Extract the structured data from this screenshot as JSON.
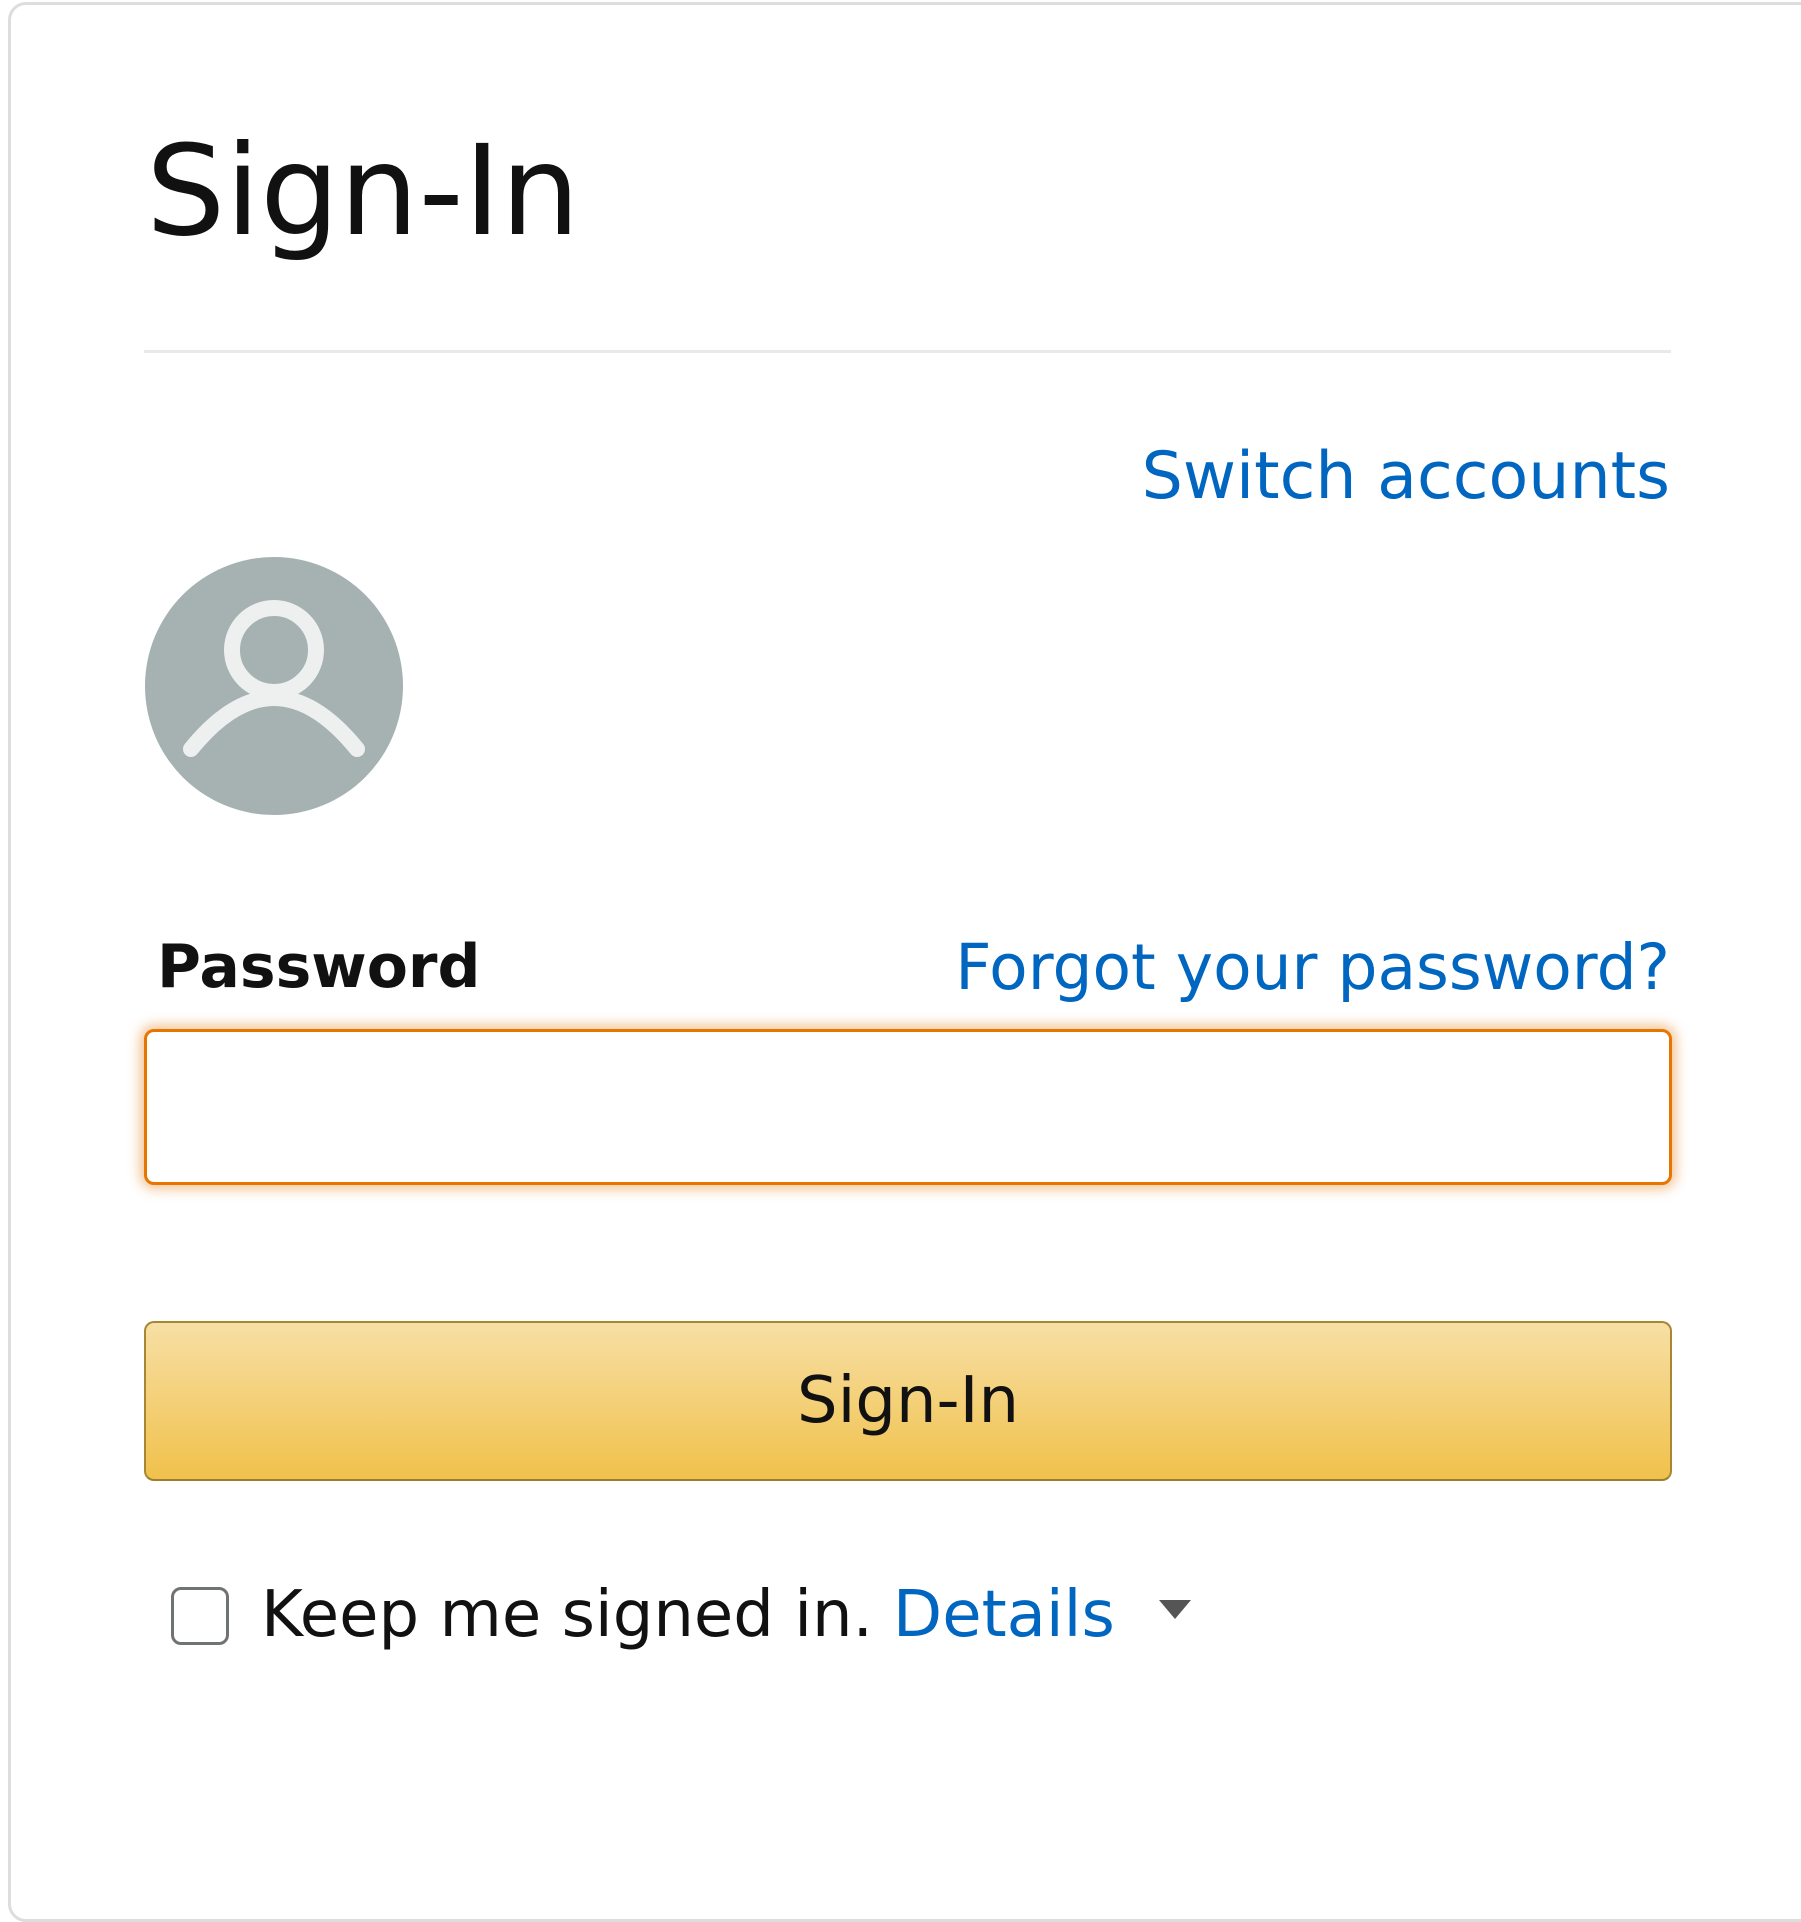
{
  "header": {
    "title": "Sign-In"
  },
  "account": {
    "switch_accounts_label": "Switch accounts",
    "avatar_icon": "default-user-icon"
  },
  "password": {
    "label": "Password",
    "forgot_label": "Forgot your password?",
    "value": "",
    "placeholder": ""
  },
  "actions": {
    "signin_label": "Sign-In"
  },
  "keep_signed_in": {
    "checked": false,
    "label": "Keep me signed in.",
    "details_label": "Details"
  },
  "colors": {
    "link": "#0066c0",
    "focus_border": "#e77600",
    "button_top": "#f7dfa5",
    "button_bottom": "#f0c14b",
    "avatar_bg": "#a6b1b2"
  }
}
